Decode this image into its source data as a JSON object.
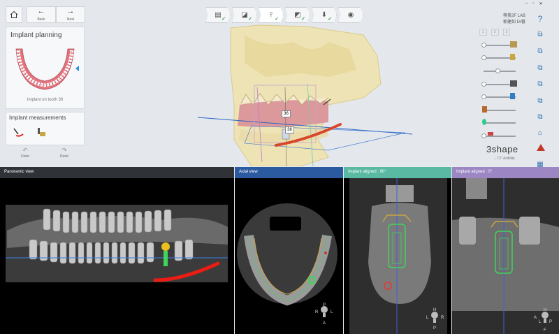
{
  "nav": {
    "home_icon": "home-icon",
    "back_label": "Back",
    "next_label": "Next"
  },
  "sidebar": {
    "panel_title": "Implant planning",
    "thumb_caption": "Implant on tooth 36",
    "measurements_title": "Implant measurements",
    "undo_label": "Undo",
    "redo_label": "Redo"
  },
  "workflow": {
    "steps": [
      "scan",
      "align",
      "implant",
      "guide",
      "export",
      "finish"
    ]
  },
  "header": {
    "lab_name": "蒋美2F LAB",
    "user": "郭建如 Dr醫"
  },
  "layers": {
    "tabs": [
      "1",
      "2",
      "3"
    ]
  },
  "brand": {
    "logo": "3shape",
    "ct_visibility": "CT visibility"
  },
  "main3d": {
    "tooth_label_top": "36",
    "tooth_label_bottom": "36"
  },
  "views": {
    "panoramic": {
      "title": "Panoramic view",
      "color": "#2f3337"
    },
    "axial": {
      "title": "Axial view",
      "color": "#2c5aa0",
      "orient": {
        "p": "P",
        "r": "R",
        "l": "L",
        "a": "A"
      }
    },
    "aligned90": {
      "title": "Implant aligned : 90°",
      "color": "#59b9a2",
      "orient": {
        "h": "H",
        "l": "L",
        "r": "R",
        "p": "P"
      }
    },
    "aligned0": {
      "title": "Implant aligned : 0°",
      "color": "#9c86c4",
      "orient": {
        "h": "H",
        "a": "A",
        "l": "L",
        "p": "P",
        "f": "F"
      }
    }
  },
  "colors": {
    "accent": "#2f6fb3",
    "check": "#2aa84a",
    "nerve": "#e02a1a",
    "implant": "#2ecc40"
  }
}
